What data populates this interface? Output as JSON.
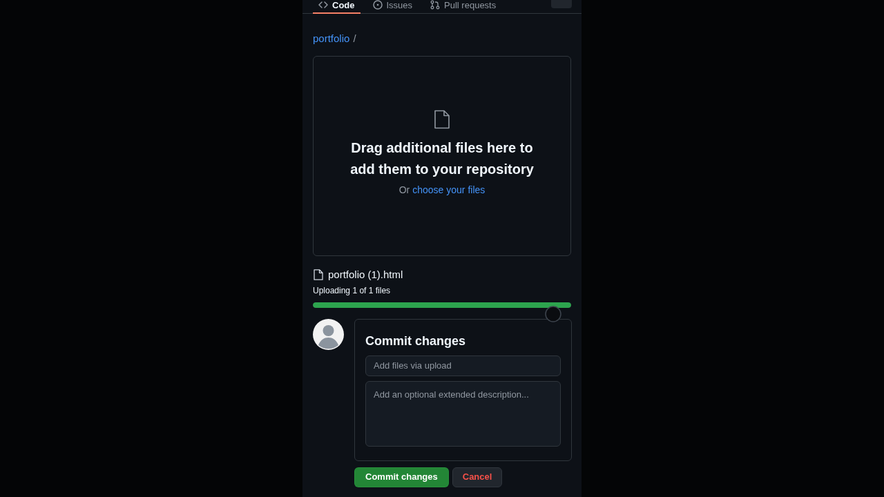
{
  "nav_tabs": [
    {
      "label": "Code",
      "selected": true
    },
    {
      "label": "Issues",
      "selected": false
    },
    {
      "label": "Pull requests",
      "selected": false
    }
  ],
  "breadcrumb": {
    "repo": "portfolio",
    "separator": "/"
  },
  "dropzone": {
    "heading": "Drag additional files here to add them to your repository",
    "prompt": "Or",
    "link": "choose your files"
  },
  "upload": {
    "file_name": "portfolio (1).html",
    "status": "Uploading 1 of 1 files",
    "level": 1
  },
  "commit": {
    "title": "Commit changes",
    "summary_placeholder": "Add files via upload",
    "description_placeholder": "Add an optional extended description..."
  },
  "buttons": [
    {
      "label": "Commit changes",
      "kind": "primary"
    },
    {
      "label": "Cancel",
      "kind": "danger"
    }
  ]
}
